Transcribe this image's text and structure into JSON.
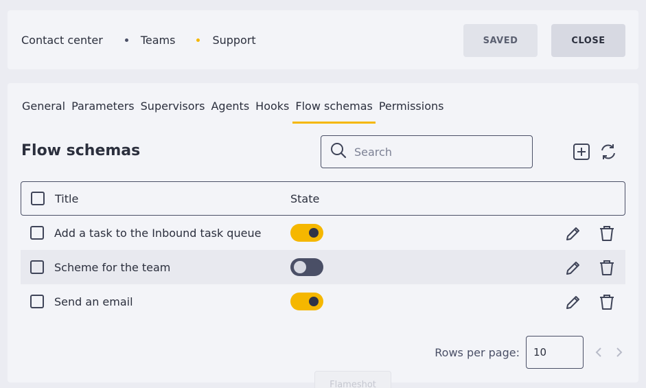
{
  "breadcrumb": {
    "items": [
      "Contact center",
      "Teams",
      "Support"
    ]
  },
  "header": {
    "saved_label": "SAVED",
    "close_label": "CLOSE"
  },
  "tabs": [
    "General",
    "Parameters",
    "Supervisors",
    "Agents",
    "Hooks",
    "Flow schemas",
    "Permissions"
  ],
  "active_tab": "Flow schemas",
  "section": {
    "title": "Flow schemas"
  },
  "search": {
    "placeholder": "Search",
    "value": ""
  },
  "table": {
    "columns": {
      "title": "Title",
      "state": "State"
    },
    "rows": [
      {
        "title": "Add a task to the Inbound task queue",
        "state": true
      },
      {
        "title": "Scheme for the team",
        "state": false
      },
      {
        "title": "Send an email",
        "state": true
      }
    ]
  },
  "pagination": {
    "rows_label": "Rows per page:",
    "rows_value": "10"
  },
  "overlay": {
    "ghost_label": "Flameshot"
  },
  "colors": {
    "accent": "#f5b700",
    "dark": "#2b2f3d",
    "toggle_off": "#4a4f66"
  },
  "icons": [
    "search-icon",
    "add-icon",
    "refresh-icon",
    "edit-icon",
    "delete-icon",
    "chevron-left-icon",
    "chevron-right-icon"
  ]
}
